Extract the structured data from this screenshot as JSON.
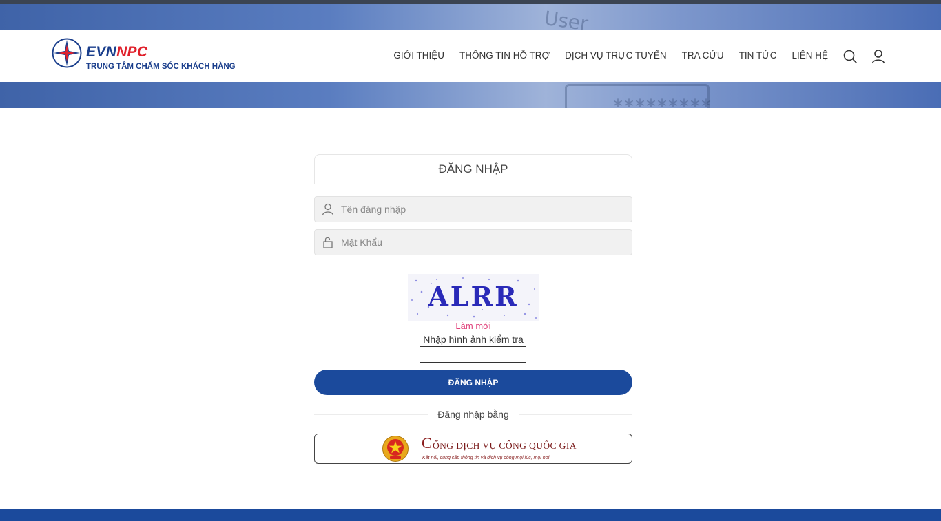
{
  "brand": {
    "name_evn": "EVN",
    "name_npc": "NPC",
    "tagline": "TRUNG TÂM CHĂM SÓC KHÁCH HÀNG",
    "colors": {
      "primary": "#1a3e8c",
      "accent": "#e0202b",
      "button": "#1b4a9c",
      "link": "#e0407a"
    }
  },
  "nav": {
    "items": [
      {
        "label": "GIỚI THIỆU"
      },
      {
        "label": "THÔNG TIN HỖ TRỢ"
      },
      {
        "label": "DỊCH VỤ TRỰC TUYẾN"
      },
      {
        "label": "TRA CỨU"
      },
      {
        "label": "TIN TỨC"
      },
      {
        "label": "LIÊN HỆ"
      }
    ],
    "icons": {
      "search": "search-icon",
      "account": "user-icon"
    }
  },
  "login": {
    "title": "ĐĂNG NHẬP",
    "username": {
      "placeholder": "Tên đăng nhập",
      "value": "",
      "icon": "user-icon"
    },
    "password": {
      "placeholder": "Mật Khẩu",
      "value": "",
      "icon": "lock-icon"
    },
    "captcha": {
      "image_text": "ALRR",
      "refresh_label": "Làm mới",
      "label": "Nhập hình ảnh kiểm tra",
      "value": ""
    },
    "submit_label": "ĐĂNG NHẬP",
    "alt_login_label": "Đăng nhập bằng",
    "national_portal": {
      "title_initial": "C",
      "title_rest": "ỔNG DỊCH VỤ CÔNG QUỐC GIA",
      "subtitle": "Kết nối, cung cấp thông tin và dịch vụ công mọi lúc, mọi nơi"
    }
  }
}
